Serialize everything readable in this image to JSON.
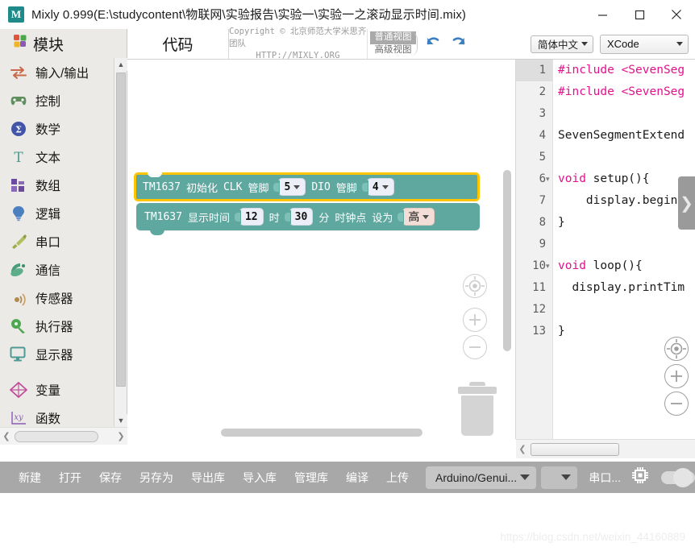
{
  "window": {
    "title": "Mixly 0.999(E:\\studycontent\\物联网\\实验报告\\实验一\\实验一之滚动显示时间.mix)",
    "logo_glyph": "M",
    "minimize_label": "minimize",
    "maximize_label": "maximize",
    "close_label": "close"
  },
  "sidebar": {
    "header": "模块",
    "items": [
      {
        "label": "输入/输出",
        "icon": "io-arrows-icon"
      },
      {
        "label": "控制",
        "icon": "gamepad-icon"
      },
      {
        "label": "数学",
        "icon": "math-circle-icon"
      },
      {
        "label": "文本",
        "icon": "text-t-icon"
      },
      {
        "label": "数组",
        "icon": "array-blocks-icon"
      },
      {
        "label": "逻辑",
        "icon": "lightbulb-icon"
      },
      {
        "label": "串口",
        "icon": "serial-plug-icon"
      },
      {
        "label": "通信",
        "icon": "satellite-icon"
      },
      {
        "label": "传感器",
        "icon": "sensor-waves-icon"
      },
      {
        "label": "执行器",
        "icon": "actuator-icon"
      },
      {
        "label": "显示器",
        "icon": "monitor-icon"
      }
    ],
    "items2": [
      {
        "label": "变量",
        "icon": "variable-diamond-icon"
      },
      {
        "label": "函数",
        "icon": "function-xy-icon"
      }
    ]
  },
  "topbar": {
    "code_tab": "代码",
    "copyright_line1": "Copyright © 北京师范大学米思齐团队",
    "copyright_line2": "HTTP://MIXLY.ORG",
    "view_normal": "普通视图",
    "view_advanced": "高级视图",
    "undo_icon": "undo-arrow-icon",
    "redo_icon": "redo-arrow-icon",
    "language": "简体中文",
    "board_mode": "XCode"
  },
  "blocks": [
    {
      "id": "tm1637-init",
      "selected": true,
      "parts": [
        {
          "type": "text",
          "value": "TM1637"
        },
        {
          "type": "text",
          "value": "初始化"
        },
        {
          "type": "text",
          "value": "CLK"
        },
        {
          "type": "text",
          "value": "管脚"
        },
        {
          "type": "dropdown",
          "value": "5"
        },
        {
          "type": "text",
          "value": "DIO"
        },
        {
          "type": "text",
          "value": "管脚"
        },
        {
          "type": "dropdown",
          "value": "4"
        }
      ]
    },
    {
      "id": "tm1637-showtime",
      "selected": false,
      "parts": [
        {
          "type": "text",
          "value": "TM1637"
        },
        {
          "type": "text",
          "value": "显示时间"
        },
        {
          "type": "number",
          "value": "12"
        },
        {
          "type": "text",
          "value": "时"
        },
        {
          "type": "number",
          "value": "30"
        },
        {
          "type": "text",
          "value": "分"
        },
        {
          "type": "text",
          "value": "时钟点"
        },
        {
          "type": "text",
          "value": "设为"
        },
        {
          "type": "dropdown-hi",
          "value": "高"
        }
      ]
    }
  ],
  "canvas_controls": {
    "center_icon": "center-target-icon",
    "zoom_in_icon": "zoom-in-icon",
    "zoom_out_icon": "zoom-out-icon",
    "trash_icon": "trash-can-icon"
  },
  "editor": {
    "lines": [
      {
        "n": "1",
        "fold": "",
        "text": "#include <SevenSeg",
        "kind": "pp"
      },
      {
        "n": "2",
        "fold": "",
        "text": "#include <SevenSeg",
        "kind": "pp"
      },
      {
        "n": "3",
        "fold": "",
        "text": "",
        "kind": "plain"
      },
      {
        "n": "4",
        "fold": "",
        "text": "SevenSegmentExtend",
        "kind": "plain"
      },
      {
        "n": "5",
        "fold": "",
        "text": "",
        "kind": "plain"
      },
      {
        "n": "6",
        "fold": "▾",
        "text": "void setup(){",
        "kind": "kw-void"
      },
      {
        "n": "7",
        "fold": "",
        "text": "    display.begin(",
        "kind": "plain"
      },
      {
        "n": "8",
        "fold": "",
        "text": "}",
        "kind": "plain"
      },
      {
        "n": "9",
        "fold": "",
        "text": "",
        "kind": "plain"
      },
      {
        "n": "10",
        "fold": "▾",
        "text": "void loop(){",
        "kind": "kw-void"
      },
      {
        "n": "11",
        "fold": "",
        "text": "  display.printTim",
        "kind": "plain"
      },
      {
        "n": "12",
        "fold": "",
        "text": "",
        "kind": "plain"
      },
      {
        "n": "13",
        "fold": "",
        "text": "}",
        "kind": "plain"
      }
    ],
    "keyword": "void",
    "panel_handle_icon": "chevron-right-icon",
    "center_icon": "center-target-icon",
    "zoom_in_icon": "zoom-in-icon",
    "zoom_out_icon": "zoom-out-icon"
  },
  "bottombar": {
    "actions": [
      "新建",
      "打开",
      "保存",
      "另存为",
      "导出库",
      "导入库",
      "管理库",
      "编译",
      "上传"
    ],
    "board": "Arduino/Genui...",
    "port_placeholder": "",
    "serial_label": "串口...",
    "chip_icon": "chip-icon",
    "toggle_icon": "toggle-switch-icon"
  },
  "footer": {
    "watermark": "https://blog.csdn.net/weixin_44160889"
  },
  "colors": {
    "block_teal": "#5fa8a0",
    "block_selected_border": "#ffc400",
    "bottombar": "#a8a8a8",
    "sidebar": "#eceae6",
    "code_keyword": "#e1128c"
  }
}
